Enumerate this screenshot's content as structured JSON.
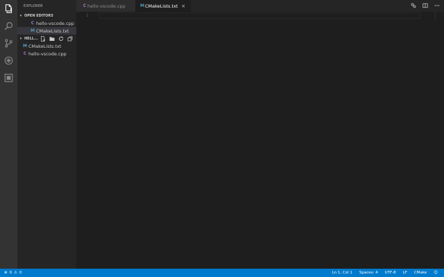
{
  "explorer": {
    "title": "EXPLORER",
    "open_editors": {
      "label": "OPEN EDITORS",
      "files": [
        {
          "name": "hello-vscode.cpp",
          "icon": "cpp-file-icon"
        },
        {
          "name": "CMakeLists.txt",
          "icon": "cmake-file-icon"
        }
      ]
    },
    "folder": {
      "label": "HELL...",
      "actions": [
        "new-file-icon",
        "new-folder-icon",
        "refresh-icon",
        "collapse-all-icon"
      ],
      "files": [
        {
          "name": "CMakeLists.txt",
          "icon": "cmake-file-icon"
        },
        {
          "name": "hello-vscode.cpp",
          "icon": "cpp-file-icon"
        }
      ]
    }
  },
  "tabs": [
    {
      "label": "hello-vscode.cpp",
      "icon": "cpp-file-icon",
      "active": false
    },
    {
      "label": "CMakeLists.txt",
      "icon": "cmake-file-icon",
      "active": true,
      "close": "×"
    }
  ],
  "editor": {
    "line_numbers": [
      "1"
    ]
  },
  "status_bar": {
    "errors": "0",
    "warnings": "0",
    "position": "Ln 1, Col 1",
    "indent": "Spaces: 4",
    "encoding": "UTF-8",
    "eol": "LF",
    "language": "CMake"
  },
  "colors": {
    "activity_bar": "#333333",
    "sidebar": "#252526",
    "editor": "#1e1e1e",
    "status_bar": "#007acc",
    "cpp_icon": "#a074c4",
    "cmake_icon": "#519aba"
  }
}
